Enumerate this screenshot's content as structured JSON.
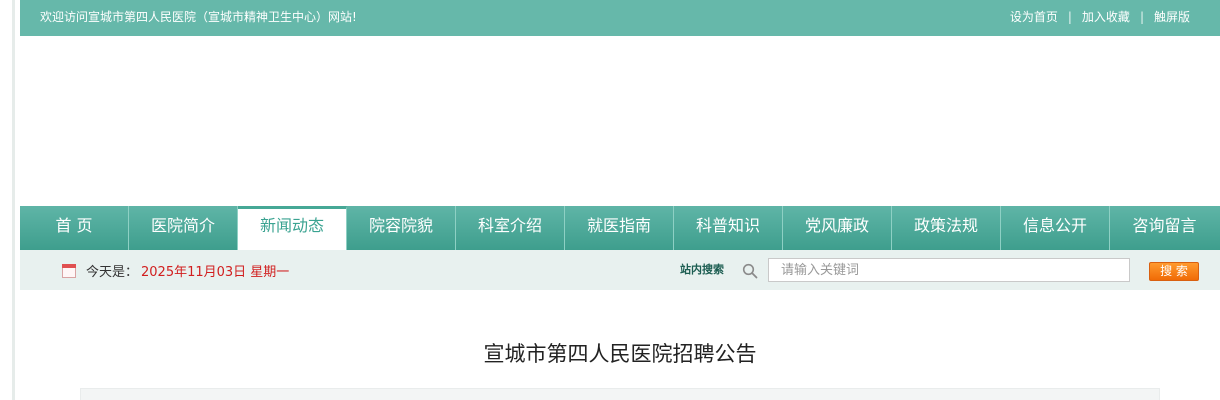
{
  "topbar": {
    "welcome": "欢迎访问宣城市第四人民医院（宣城市精神卫生中心）网站!",
    "links": [
      "设为首页",
      "加入收藏",
      "触屏版"
    ],
    "separator": "|"
  },
  "nav": {
    "items": [
      "首 页",
      "医院简介",
      "新闻动态",
      "院容院貌",
      "科室介绍",
      "就医指南",
      "科普知识",
      "党风廉政",
      "政策法规",
      "信息公开",
      "咨询留言"
    ],
    "active_index": 2
  },
  "infobar": {
    "date_label": "今天是：",
    "date_value": "2025年11月03日 星期一",
    "search_label": "站内搜索",
    "search_placeholder": "请输入关键词",
    "search_button": "搜 索"
  },
  "article": {
    "title": "宣城市第四人民医院招聘公告"
  },
  "colors": {
    "topbar": "#66b8aa",
    "nav": "#4aa898",
    "date_red": "#d11f1f",
    "search_button": "#f47a12"
  }
}
